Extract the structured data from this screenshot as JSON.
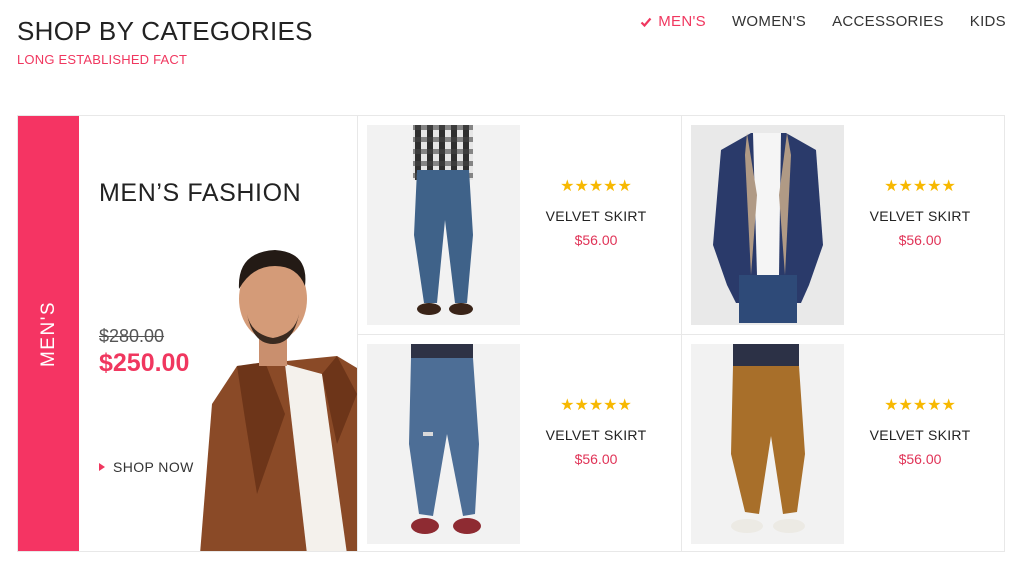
{
  "header": {
    "title": "SHOP BY CATEGORIES",
    "subtitle": "LONG ESTABLISHED FACT"
  },
  "tabs": [
    {
      "label": "MEN'S",
      "active": true,
      "icon": "check-icon"
    },
    {
      "label": "WOMEN'S",
      "active": false
    },
    {
      "label": "ACCESSORIES",
      "active": false
    },
    {
      "label": "KIDS",
      "active": false
    }
  ],
  "category_label": "MEN'S",
  "feature": {
    "title": "MEN’S FASHION",
    "old_price": "$280.00",
    "new_price": "$250.00",
    "cta": "SHOP NOW"
  },
  "products": [
    {
      "name": "VELVET SKIRT",
      "price": "$56.00",
      "stars": "★★★★★",
      "rating": 5
    },
    {
      "name": "VELVET SKIRT",
      "price": "$56.00",
      "stars": "★★★★★",
      "rating": 5
    },
    {
      "name": "VELVET SKIRT",
      "price": "$56.00",
      "stars": "★★★★★",
      "rating": 5
    },
    {
      "name": "VELVET SKIRT",
      "price": "$56.00",
      "stars": "★★★★★",
      "rating": 5
    }
  ],
  "colors": {
    "accent": "#f0375f",
    "side_bar": "#f53463",
    "stars": "#f7b801"
  }
}
